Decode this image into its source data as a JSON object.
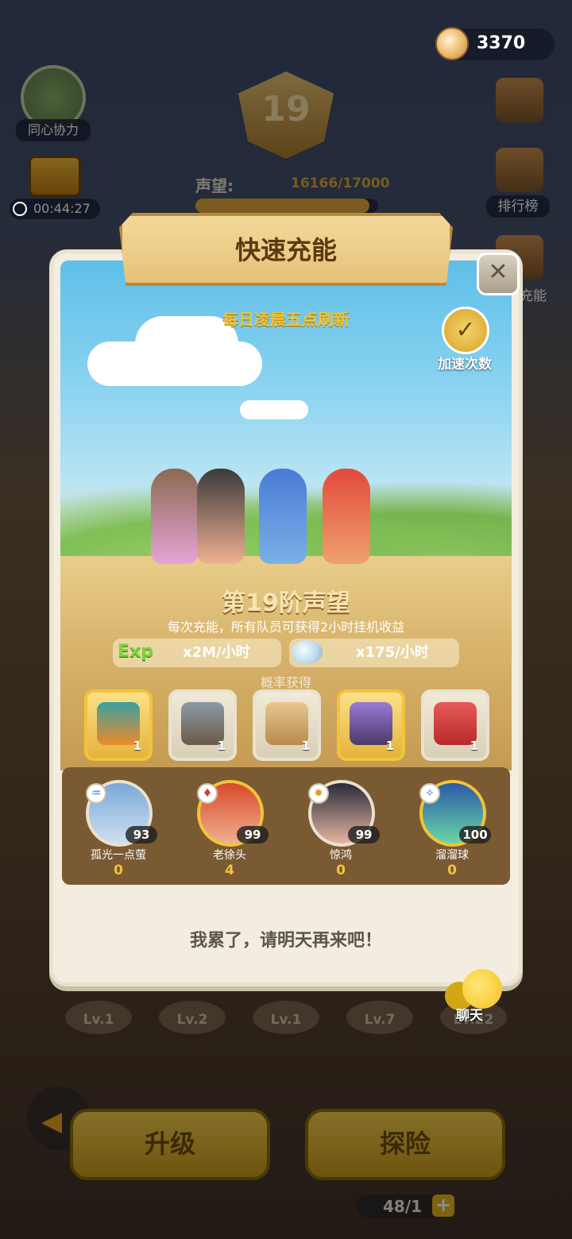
{
  "currency": {
    "amount": "3370"
  },
  "topleft": {
    "team_label": "同心协力",
    "timer": "00:44:27"
  },
  "rank": {
    "level": "19",
    "prestige_label": "声望:",
    "prestige_value": "16166/17000",
    "prestige_progress": 0.951
  },
  "right_menu": {
    "rank_label": "排行榜",
    "charge_label": "充能"
  },
  "modal": {
    "title": "快速充能",
    "refresh_note": "每日凌晨五点刷新",
    "speed_label": "加速次数",
    "tier_title": "第19阶声望",
    "tier_desc": "每次充能，所有队员可获得2小时挂机收益",
    "exp_tag": "Exp",
    "exp_rate": "x2M/小时",
    "pearl_rate": "x175/小时",
    "prob_label": "概率获得",
    "rewards": [
      {
        "name": "carrot-bag",
        "count": "1",
        "highlight": true
      },
      {
        "name": "silver-chest",
        "count": "1",
        "highlight": false
      },
      {
        "name": "mystery-crystal",
        "count": "1",
        "highlight": false
      },
      {
        "name": "purple-chest",
        "count": "1",
        "highlight": true
      },
      {
        "name": "red-scroll",
        "count": "1",
        "highlight": false
      }
    ],
    "members": [
      {
        "name": "孤光一点萤",
        "level": "93",
        "count": "0"
      },
      {
        "name": "老徐头",
        "level": "99",
        "count": "4"
      },
      {
        "name": "惊鸿",
        "level": "99",
        "count": "0"
      },
      {
        "name": "溜溜球",
        "level": "100",
        "count": "0"
      }
    ],
    "tired_msg": "我累了，请明天再来吧！"
  },
  "pets": [
    "Lv.1",
    "Lv.2",
    "Lv.1",
    "Lv.7",
    "Lv.22"
  ],
  "bottom": {
    "upgrade": "升级",
    "explore": "探险",
    "food": "48/1",
    "plus": "+"
  },
  "chat": {
    "label": "聊天"
  }
}
